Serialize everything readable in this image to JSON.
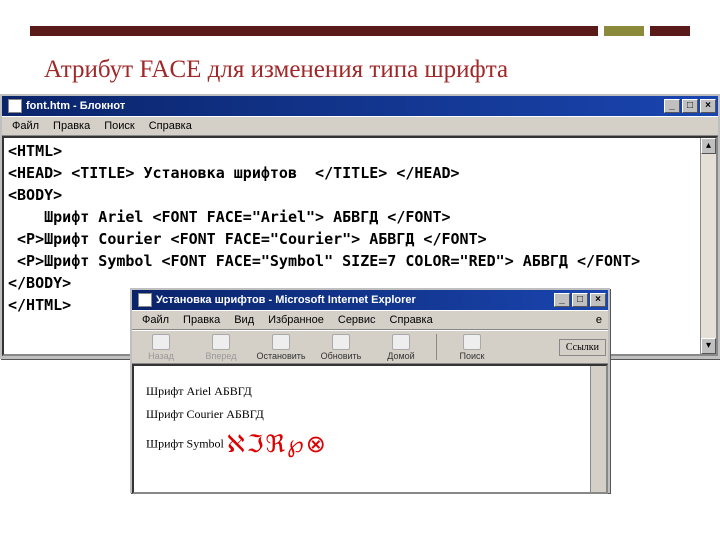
{
  "slide": {
    "title": "Атрибут FACE для изменения типа шрифта"
  },
  "notepad": {
    "title": "font.htm - Блокнот",
    "menus": {
      "file": "Файл",
      "edit": "Правка",
      "search": "Поиск",
      "help": "Справка"
    },
    "code": "<HTML>\n<HEAD> <TITLE> Установка шрифтов  </TITLE> </HEAD>\n<BODY>\n    Шрифт Ariel <FONT FACE=\"Ariel\"> АБВГД </FONT>\n <P>Шрифт Courier <FONT FACE=\"Courier\"> АБВГД </FONT>\n <P>Шрифт Symbol <FONT FACE=\"Symbol\" SIZE=7 COLOR=\"RED\"> АБВГД </FONT>\n</BODY>\n</HTML>"
  },
  "ie": {
    "title": "Установка шрифтов - Microsoft Internet Explorer",
    "menus": {
      "file": "Файл",
      "edit": "Правка",
      "view": "Вид",
      "fav": "Избранное",
      "tools": "Сервис",
      "help": "Справка"
    },
    "toolbar": {
      "back": "Назад",
      "fwd": "Вперед",
      "stop": "Остановить",
      "refresh": "Обновить",
      "home": "Домой",
      "search": "Поиск",
      "links": "Ссылки"
    },
    "content": {
      "line1": "Шрифт Ariel АБВГД",
      "line2": "Шрифт Courier АБВГД",
      "line3_prefix": "Шрифт Symbol ",
      "line3_symbol": "ℵℑℜ℘⊗"
    }
  },
  "winbtn": {
    "min": "_",
    "max": "□",
    "close": "×"
  }
}
